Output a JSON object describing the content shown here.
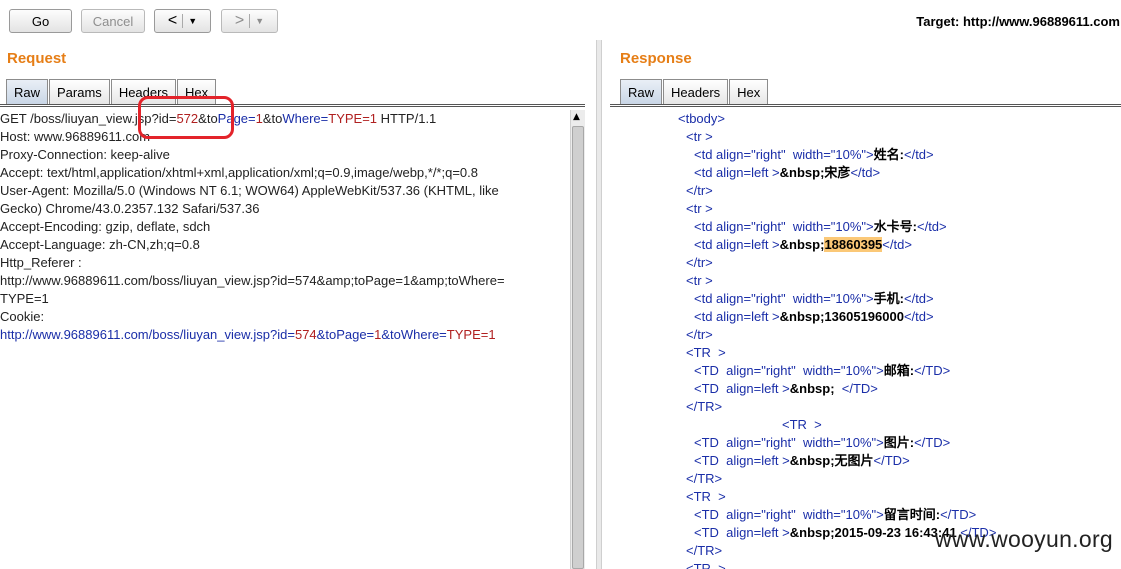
{
  "toolbar": {
    "go_label": "Go",
    "cancel_label": "Cancel",
    "back_glyph": "<",
    "forward_glyph": ">",
    "dropdown_glyph": "▼",
    "target_label": "Target: http://www.96889611.com"
  },
  "request": {
    "title": "Request",
    "tabs": [
      "Raw",
      "Params",
      "Headers",
      "Hex"
    ],
    "active_tab": "Raw",
    "line1": {
      "method": "GET /boss/liuyan_view.jsp?id=",
      "id_value": "572",
      "amp1": "&to",
      "page_key": "Page=",
      "page_val": "1",
      "amp2": "&to",
      "where_key": "Where=",
      "where_val": "TYPE=1",
      "proto": " HTTP/1.1"
    },
    "lines": [
      "Host: www.96889611.com",
      "Proxy-Connection: keep-alive",
      "Accept: text/html,application/xhtml+xml,application/xml;q=0.9,image/webp,*/*;q=0.8",
      "User-Agent: Mozilla/5.0 (Windows NT 6.1; WOW64) AppleWebKit/537.36 (KHTML, like",
      "Gecko) Chrome/43.0.2357.132 Safari/537.36",
      "Accept-Encoding: gzip, deflate, sdch",
      "Accept-Language: zh-CN,zh;q=0.8",
      "Http_Referer :",
      "http://www.96889611.com/boss/liuyan_view.jsp?id=574&amp;toPage=1&amp;toWhere=",
      "TYPE=1",
      "Cookie:"
    ],
    "last_line": {
      "url": "http://www.96889611.com/boss/liuyan_view.jsp?id=",
      "id_value": "574",
      "amp1": "&to",
      "page_key": "Page=",
      "page_val": "1",
      "amp2": "&to",
      "where_key": "Where=",
      "where_val": "TYPE=1"
    }
  },
  "response": {
    "title": "Response",
    "tabs": [
      "Raw",
      "Headers",
      "Hex"
    ],
    "active_tab": "Raw",
    "lines": [
      {
        "indent": 68,
        "tag": "<tbody>"
      },
      {
        "indent": 76,
        "tag": "<tr >"
      },
      {
        "indent": 84,
        "tag": "<td align=\"right\"  width=\"10%\">",
        "text": "姓名:",
        "close": "</td>"
      },
      {
        "indent": 84,
        "tag": "<td align=left >",
        "text": "&nbsp;宋彦",
        "close": "</td>"
      },
      {
        "indent": 76,
        "tag": "</tr>"
      },
      {
        "indent": 76,
        "tag": "<tr >"
      },
      {
        "indent": 84,
        "tag": "<td align=\"right\"  width=\"10%\">",
        "text": "水卡号:",
        "close": "</td>"
      },
      {
        "indent": 84,
        "tag": "<td align=left >",
        "text": "&nbsp;",
        "hl": "18860395",
        "close": "</td>"
      },
      {
        "indent": 76,
        "tag": "</tr>"
      },
      {
        "indent": 76,
        "tag": "<tr >"
      },
      {
        "indent": 84,
        "tag": "<td align=\"right\"  width=\"10%\">",
        "text": "手机:",
        "close": "</td>"
      },
      {
        "indent": 84,
        "tag": "<td align=left >",
        "text": "&nbsp;13605196000",
        "close": "</td>"
      },
      {
        "indent": 76,
        "tag": "</tr>"
      },
      {
        "indent": 76,
        "tag": "<TR  >"
      },
      {
        "indent": 84,
        "tag": "<TD  align=\"right\"  width=\"10%\">",
        "text": "邮箱:",
        "close": "</TD>"
      },
      {
        "indent": 84,
        "tag": "<TD  align=left >",
        "text": "&nbsp;  ",
        "close": "</TD>"
      },
      {
        "indent": 76,
        "tag": "</TR>"
      },
      {
        "indent": 172,
        "tag": "<TR  >"
      },
      {
        "indent": 84,
        "tag": "<TD  align=\"right\"  width=\"10%\">",
        "text": "图片:",
        "close": "</TD>"
      },
      {
        "indent": 84,
        "tag": "<TD  align=left >",
        "text": "&nbsp;无图片",
        "close": "</TD>"
      },
      {
        "indent": 76,
        "tag": "</TR>"
      },
      {
        "indent": 76,
        "tag": "<TR  >"
      },
      {
        "indent": 84,
        "tag": "<TD  align=\"right\"  width=\"10%\">",
        "text": "留言时间:",
        "close": "</TD>"
      },
      {
        "indent": 84,
        "tag": "<TD  align=left >",
        "text": "&nbsp;2015-09-23 16:43:41 ",
        "close": "</TD>"
      },
      {
        "indent": 76,
        "tag": "</TR>"
      },
      {
        "indent": 76,
        "tag": "<TR  >"
      }
    ]
  },
  "watermark": "www.wooyun.org",
  "colors": {
    "section_title": "#e67e16",
    "annotation": "#e3232a",
    "highlight": "#fbc877"
  }
}
